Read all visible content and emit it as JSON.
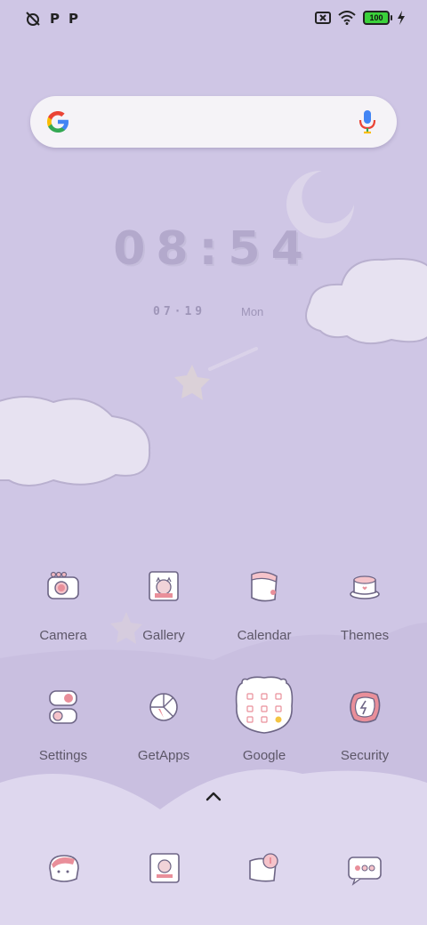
{
  "status_bar": {
    "left_icons": [
      "alarm-off-icon",
      "p-notification-icon",
      "p-notification-icon"
    ],
    "right_icons": [
      "sim-off-icon",
      "wifi-icon",
      "battery-icon",
      "charging-bolt-icon"
    ],
    "battery_level": "100",
    "colors": {
      "battery_fill": "#3bd13b"
    }
  },
  "search_bar": {
    "logo": "google-g-icon",
    "mic": "mic-icon"
  },
  "clock": {
    "time": "08:54",
    "date": "07·19",
    "day": "Mon"
  },
  "apps_row1": [
    {
      "label": "Camera",
      "icon": "camera-icon"
    },
    {
      "label": "Gallery",
      "icon": "gallery-icon"
    },
    {
      "label": "Calendar",
      "icon": "calendar-icon"
    },
    {
      "label": "Themes",
      "icon": "themes-icon"
    }
  ],
  "apps_row2": [
    {
      "label": "Settings",
      "icon": "settings-icon"
    },
    {
      "label": "GetApps",
      "icon": "getapps-icon"
    },
    {
      "label": "Google",
      "icon": "google-folder-icon"
    },
    {
      "label": "Security",
      "icon": "security-icon"
    }
  ],
  "drawer_handle": "chevron-up-icon",
  "dock": [
    {
      "icon": "phone-icon"
    },
    {
      "icon": "messages-icon"
    },
    {
      "icon": "browser-icon"
    },
    {
      "icon": "chat-icon"
    }
  ],
  "theme_colors": {
    "background": "#cfc6e5",
    "accent_pink": "#e98f9a",
    "outline": "#6d6585"
  }
}
